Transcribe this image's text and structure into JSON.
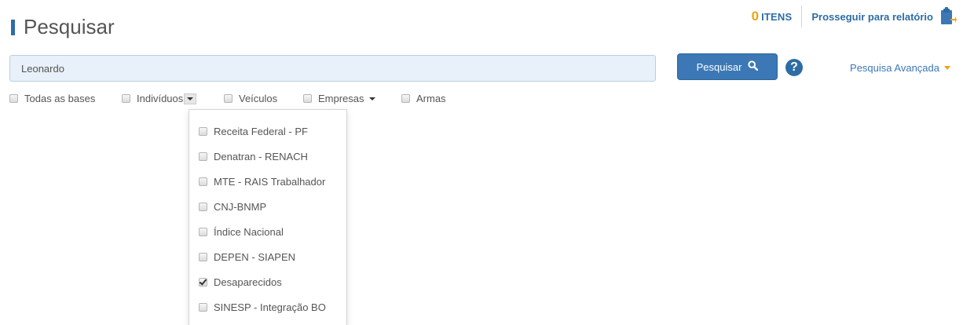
{
  "header": {
    "title": "Pesquisar",
    "items_count": "0",
    "items_label": "ITENS",
    "report_link": "Prosseguir para relatório"
  },
  "search": {
    "value": "Leonardo",
    "button_label": "Pesquisar",
    "help_symbol": "?",
    "advanced_label": "Pesquisa Avançada"
  },
  "filters": {
    "all_bases": "Todas as bases",
    "individuos": "Indivíduos",
    "veiculos": "Veículos",
    "empresas": "Empresas",
    "armas": "Armas"
  },
  "dropdown": {
    "items": [
      {
        "label": "Receita Federal - PF",
        "checked": false
      },
      {
        "label": "Denatran - RENACH",
        "checked": false
      },
      {
        "label": "MTE - RAIS Trabalhador",
        "checked": false
      },
      {
        "label": "CNJ-BNMP",
        "checked": false
      },
      {
        "label": "Índice Nacional",
        "checked": false
      },
      {
        "label": "DEPEN - SIAPEN",
        "checked": false
      },
      {
        "label": "Desaparecidos",
        "checked": true
      },
      {
        "label": "SINESP - Integração BO",
        "checked": false
      }
    ]
  },
  "icons": {
    "search": "search-icon",
    "help": "help-icon",
    "clipboard": "clipboard-icon",
    "caret": "caret-down-icon"
  },
  "colors": {
    "accent": "#2e6da4",
    "button": "#3b78b5",
    "orange": "#f0a30a",
    "input_bg": "#e8f0f9"
  }
}
